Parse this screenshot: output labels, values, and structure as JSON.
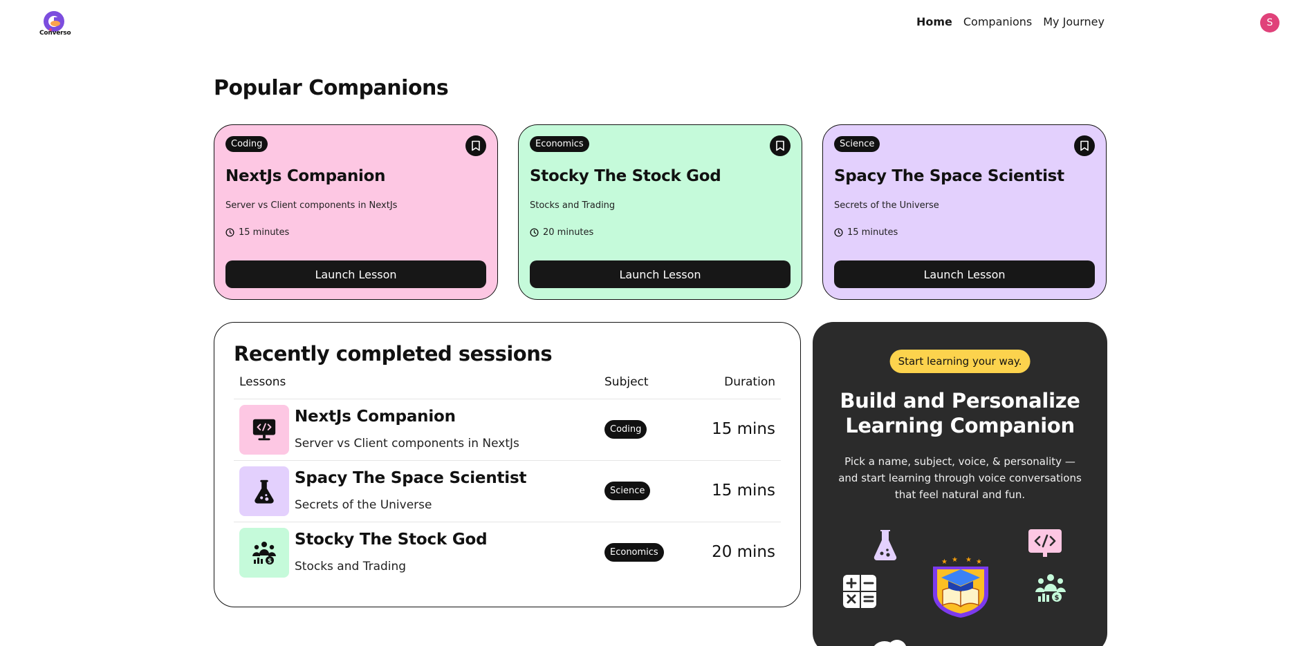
{
  "nav": {
    "logo_text": "Converso",
    "links": [
      {
        "label": "Home",
        "active": true
      },
      {
        "label": "Companions",
        "active": false
      },
      {
        "label": "My Journey",
        "active": false
      }
    ],
    "avatar_initial": "S"
  },
  "popular": {
    "title": "Popular Companions",
    "cards": [
      {
        "subject": "Coding",
        "name": "NextJs Companion",
        "topic": "Server vs Client components in NextJs",
        "duration": "15 minutes",
        "button": "Launch Lesson",
        "color": "#fdc7e3"
      },
      {
        "subject": "Economics",
        "name": "Stocky The Stock God",
        "topic": "Stocks and Trading",
        "duration": "20 minutes",
        "button": "Launch Lesson",
        "color": "#c5fada"
      },
      {
        "subject": "Science",
        "name": "Spacy The Space Scientist",
        "topic": "Secrets of the Universe",
        "duration": "15 minutes",
        "button": "Launch Lesson",
        "color": "#e3d0fd"
      }
    ]
  },
  "recent": {
    "title": "Recently completed sessions",
    "columns": {
      "lessons": "Lessons",
      "subject": "Subject",
      "duration": "Duration"
    },
    "rows": [
      {
        "name": "NextJs Companion",
        "topic": "Server vs Client components in NextJs",
        "subject": "Coding",
        "duration": "15 mins",
        "icon": "code-monitor-icon",
        "color": "#fdc7e3"
      },
      {
        "name": "Spacy The Space Scientist",
        "topic": "Secrets of the Universe",
        "subject": "Science",
        "duration": "15 mins",
        "icon": "flask-icon",
        "color": "#e3d0fd"
      },
      {
        "name": "Stocky The Stock God",
        "topic": "Stocks and Trading",
        "subject": "Economics",
        "duration": "20 mins",
        "icon": "people-chart-icon",
        "color": "#c5fada"
      }
    ]
  },
  "cta": {
    "pill": "Start learning your way.",
    "title": "Build and Personalize Learning Companion",
    "text": "Pick a name, subject, voice, & personality — and start learning through voice conversations that feel natural and fun.",
    "accent": "#fcd34d"
  }
}
